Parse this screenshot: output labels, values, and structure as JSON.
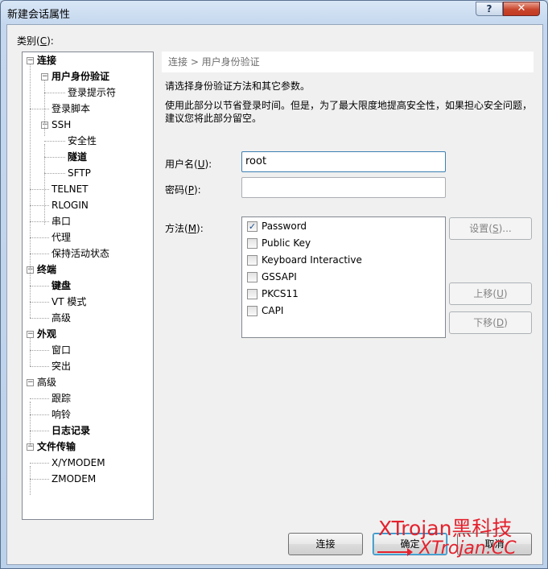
{
  "window": {
    "title": "新建会话属性",
    "help_label": "?",
    "close_label": "✕"
  },
  "category": {
    "label_prefix": "类别(",
    "label_key": "C",
    "label_suffix": "):"
  },
  "tree": [
    {
      "label": "连接",
      "bold": true,
      "expander": "−"
    },
    {
      "label": "用户身份验证",
      "bold": true,
      "expander": "−"
    },
    {
      "label": "登录提示符",
      "bold": false
    },
    {
      "label": "登录脚本",
      "bold": false
    },
    {
      "label": "SSH",
      "bold": false,
      "expander": "−"
    },
    {
      "label": "安全性",
      "bold": false
    },
    {
      "label": "隧道",
      "bold": true
    },
    {
      "label": "SFTP",
      "bold": false
    },
    {
      "label": "TELNET",
      "bold": false
    },
    {
      "label": "RLOGIN",
      "bold": false
    },
    {
      "label": "串口",
      "bold": false
    },
    {
      "label": "代理",
      "bold": false
    },
    {
      "label": "保持活动状态",
      "bold": false
    },
    {
      "label": "终端",
      "bold": true,
      "expander": "−"
    },
    {
      "label": "键盘",
      "bold": true
    },
    {
      "label": "VT 模式",
      "bold": false
    },
    {
      "label": "高级",
      "bold": false
    },
    {
      "label": "外观",
      "bold": true,
      "expander": "−"
    },
    {
      "label": "窗口",
      "bold": false
    },
    {
      "label": "突出",
      "bold": false
    },
    {
      "label": "高级",
      "bold": false,
      "expander": "−"
    },
    {
      "label": "跟踪",
      "bold": false
    },
    {
      "label": "响铃",
      "bold": false
    },
    {
      "label": "日志记录",
      "bold": true
    },
    {
      "label": "文件传输",
      "bold": true,
      "expander": "−"
    },
    {
      "label": "X/YMODEM",
      "bold": false
    },
    {
      "label": "ZMODEM",
      "bold": false
    }
  ],
  "breadcrumb": "连接 > 用户身份验证",
  "intro": "请选择身份验证方法和其它参数。",
  "description_line1": "使用此部分以节省登录时间。但是，为了最大限度地提高安全性，如果担心安全问题，",
  "description_line2": "建议您将此部分留空。",
  "username": {
    "label_prefix": "用户名(",
    "label_key": "U",
    "label_suffix": "):",
    "value": "root"
  },
  "password": {
    "label_prefix": "密码(",
    "label_key": "P",
    "label_suffix": "):",
    "value": ""
  },
  "method": {
    "label_prefix": "方法(",
    "label_key": "M",
    "label_suffix": "):"
  },
  "methods": [
    {
      "label": "Password",
      "checked": true
    },
    {
      "label": "Public Key",
      "checked": false
    },
    {
      "label": "Keyboard Interactive",
      "checked": false
    },
    {
      "label": "GSSAPI",
      "checked": false
    },
    {
      "label": "PKCS11",
      "checked": false
    },
    {
      "label": "CAPI",
      "checked": false
    }
  ],
  "buttons": {
    "settings": {
      "prefix": "设置(",
      "key": "S",
      "suffix": ")..."
    },
    "move_up": {
      "prefix": "上移(",
      "key": "U",
      "suffix": ")"
    },
    "move_down": {
      "prefix": "下移(",
      "key": "D",
      "suffix": ")"
    },
    "connect": "连接",
    "ok": "确定",
    "cancel": "取消"
  },
  "watermark": {
    "line1": "XTrojan黑科技",
    "line2": "XTrojan.CC"
  },
  "colors": {
    "watermark": "#e3222e",
    "title_bar": "#c4d7ee",
    "close_button": "#c9452c"
  }
}
